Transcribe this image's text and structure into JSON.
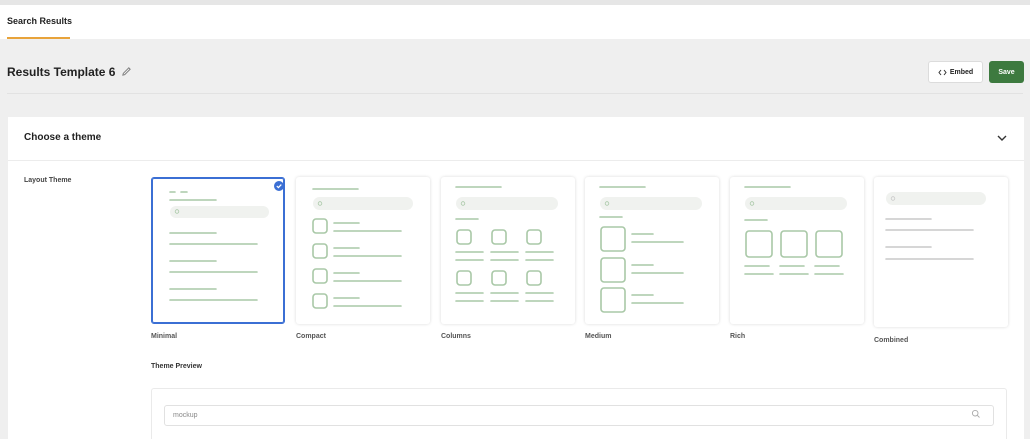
{
  "tabs": [
    {
      "label": "Search Results",
      "active": true
    }
  ],
  "header": {
    "title": "Results Template 6",
    "edit_icon": "pencil-icon",
    "embed_label": "Embed",
    "embed_icon": "code-brackets-icon",
    "save_label": "Save"
  },
  "section": {
    "title": "Choose a theme",
    "collapse_icon": "chevron-down-icon",
    "layout_label": "Layout Theme"
  },
  "themes": [
    {
      "name": "Minimal",
      "selected": true
    },
    {
      "name": "Compact",
      "selected": false
    },
    {
      "name": "Columns",
      "selected": false
    },
    {
      "name": "Medium",
      "selected": false
    },
    {
      "name": "Rich",
      "selected": false
    },
    {
      "name": "Combined",
      "selected": false
    }
  ],
  "preview": {
    "label": "Theme Preview",
    "search_value": "mockup",
    "search_icon": "search-icon"
  },
  "colors": {
    "accent_tab": "#e8a33a",
    "save_button": "#3d7a3f",
    "selected_border": "#3b6fd4",
    "mockup_green": "#a9c8a7",
    "mockup_gray": "#c9c9c9"
  }
}
